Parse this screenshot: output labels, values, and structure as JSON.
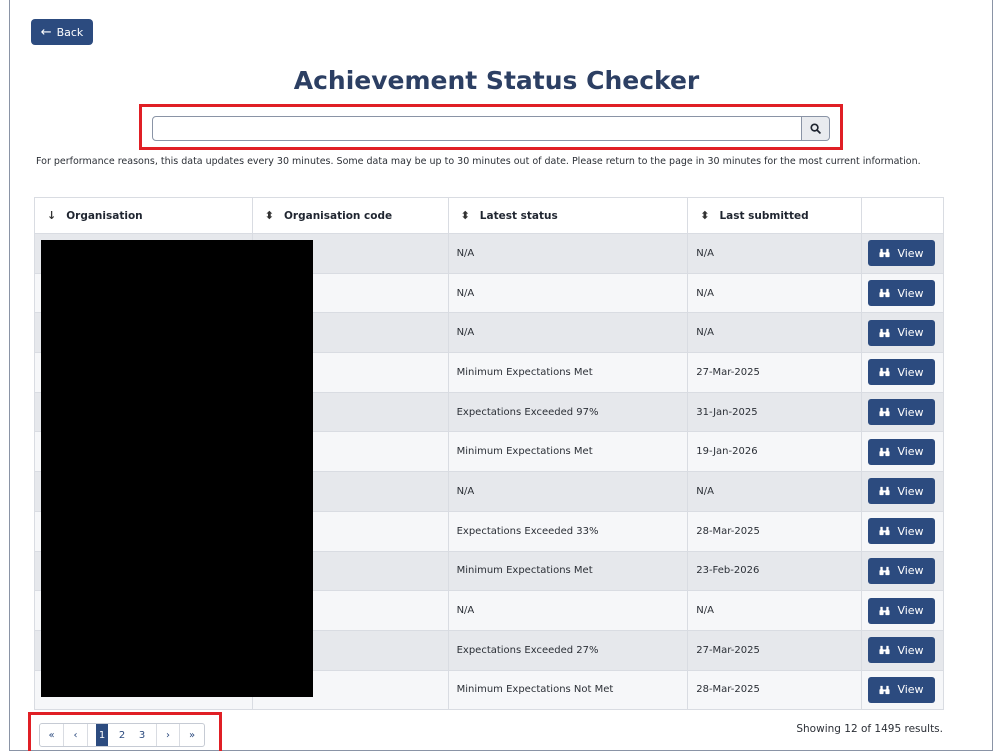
{
  "back": {
    "label": "Back"
  },
  "page_title": "Achievement Status Checker",
  "search": {
    "value": "",
    "placeholder": ""
  },
  "notice": "For performance reasons, this data updates every 30 minutes. Some data may be up to 30 minutes out of date. Please return to the page in 30 minutes for the most current information.",
  "table": {
    "headers": [
      "Organisation",
      "Organisation code",
      "Latest status",
      "Last submitted"
    ],
    "sort_icons": [
      "↓",
      "⬍",
      "⬍",
      "⬍"
    ],
    "view_label": "View",
    "rows": [
      {
        "status": "N/A",
        "submitted": "N/A"
      },
      {
        "status": "N/A",
        "submitted": "N/A"
      },
      {
        "status": "N/A",
        "submitted": "N/A"
      },
      {
        "status": "Minimum Expectations Met",
        "submitted": "27-Mar-2025"
      },
      {
        "status": "Expectations Exceeded 97%",
        "submitted": "31-Jan-2025"
      },
      {
        "status": "Minimum Expectations Met",
        "submitted": "19-Jan-2026"
      },
      {
        "status": "N/A",
        "submitted": "N/A"
      },
      {
        "status": "Expectations Exceeded 33%",
        "submitted": "28-Mar-2025"
      },
      {
        "status": "Minimum Expectations Met",
        "submitted": "23-Feb-2026"
      },
      {
        "status": "N/A",
        "submitted": "N/A"
      },
      {
        "status": "Expectations Exceeded 27%",
        "submitted": "27-Mar-2025"
      },
      {
        "status": "Minimum Expectations Not Met",
        "submitted": "28-Mar-2025"
      }
    ]
  },
  "pagination": {
    "first": "«",
    "prev": "‹",
    "pages": [
      "1",
      "2",
      "3"
    ],
    "current": "1",
    "next": "›",
    "last": "»"
  },
  "results_text": "Showing 12 of 1495 results.",
  "colors": {
    "primary": "#2c4b7f",
    "highlight": "#e01f25",
    "title": "#2c3f63"
  }
}
